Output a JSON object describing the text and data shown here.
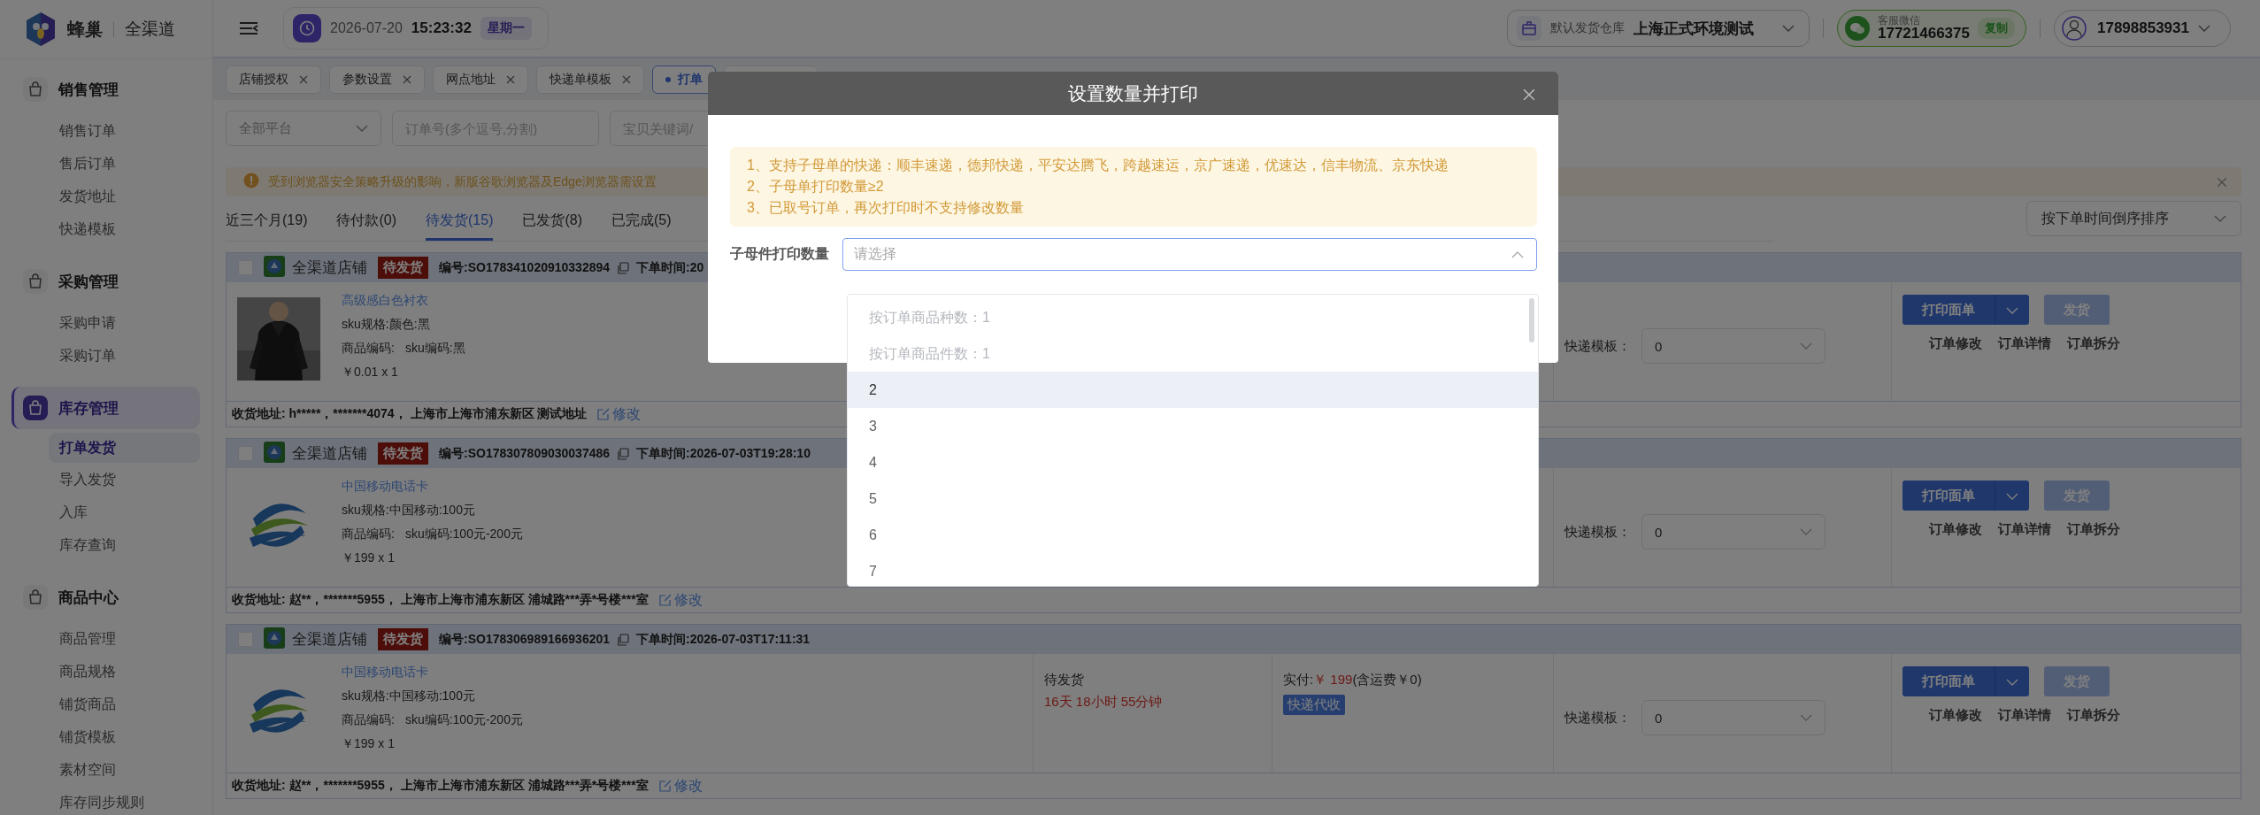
{
  "sidebar": {
    "brand": "蜂巢",
    "brand_sub": "全渠道",
    "groups": [
      {
        "title": "销售管理",
        "selected": false,
        "items": [
          {
            "label": "销售订单",
            "selected": false
          },
          {
            "label": "售后订单",
            "selected": false
          },
          {
            "label": "发货地址",
            "selected": false
          },
          {
            "label": "快递模板",
            "selected": false
          }
        ]
      },
      {
        "title": "采购管理",
        "selected": false,
        "items": [
          {
            "label": "采购申请",
            "selected": false
          },
          {
            "label": "采购订单",
            "selected": false
          }
        ]
      },
      {
        "title": "库存管理",
        "selected": true,
        "items": [
          {
            "label": "打单发货",
            "selected": true
          },
          {
            "label": "导入发货",
            "selected": false
          },
          {
            "label": "入库",
            "selected": false
          },
          {
            "label": "库存查询",
            "selected": false
          }
        ]
      },
      {
        "title": "商品中心",
        "selected": false,
        "items": [
          {
            "label": "商品管理",
            "selected": false
          },
          {
            "label": "商品规格",
            "selected": false
          },
          {
            "label": "铺货商品",
            "selected": false
          },
          {
            "label": "铺货模板",
            "selected": false
          },
          {
            "label": "素材空间",
            "selected": false
          },
          {
            "label": "库存同步规则",
            "selected": false
          }
        ]
      }
    ]
  },
  "header": {
    "date": "2026-07-20",
    "time": "15:23:32",
    "weekday": "星期一",
    "warehouse": {
      "label": "默认发货仓库",
      "value": "上海正式环境测试"
    },
    "wechat": {
      "label": "客服微信",
      "number": "17721466375",
      "copy": "复制"
    },
    "user": "17898853931"
  },
  "page_tabs": [
    {
      "kind": "text",
      "label": "店铺授权",
      "selected": false
    },
    {
      "kind": "text",
      "label": "参数设置",
      "selected": false
    },
    {
      "kind": "text",
      "label": "网点地址",
      "selected": false
    },
    {
      "kind": "text",
      "label": "快递单模板",
      "selected": false
    },
    {
      "kind": "text",
      "label": "打单",
      "selected": true
    },
    {
      "kind": "blank",
      "selected": false
    }
  ],
  "filters": {
    "platform": "全部平台",
    "order_no": {
      "placeholder": "订单号(多个逗号,分割)"
    },
    "keyword": {
      "placeholder": "宝贝关键词/"
    }
  },
  "alert": "受到浏览器安全策略升级的影响，新版谷歌浏览器及Edge浏览器需设置",
  "status_tabs": [
    {
      "label": "近三个月(19)",
      "selected": false
    },
    {
      "label": "待付款(0)",
      "selected": false
    },
    {
      "label": "待发货(15)",
      "selected": true
    },
    {
      "label": "已发货(8)",
      "selected": false
    },
    {
      "label": "已完成(5)",
      "selected": false
    }
  ],
  "sort": "按下单时间倒序排序",
  "orders": [
    {
      "checked": false,
      "store": "全渠道店铺",
      "badge": "待发货",
      "order_no": "编号:SO178341020910332894",
      "order_time": "下单时间:20",
      "product": {
        "name": "高级感白色衬衣",
        "sku": "sku规格:颜色:黑",
        "code_label": "商品编码:",
        "code": "sku编码:黑",
        "price": "￥0.01 x 1"
      },
      "address": "收货地址: h*****，*******4074， 上海市上海市浦东新区 测试地址",
      "edit": "修改",
      "template_label": "快递模板：",
      "template": "0",
      "print": "打印面单",
      "ship": "发货",
      "ship_disabled": true,
      "links": [
        "订单修改",
        "订单详情",
        "订单拆分"
      ]
    },
    {
      "checked": false,
      "store": "全渠道店铺",
      "badge": "待发货",
      "order_no": "编号:SO178307809030037486",
      "order_time": "下单时间:2026-07-03T19:28:10",
      "product": {
        "kind": "logo",
        "name": "中国移动电话卡",
        "sku": "sku规格:中国移动:100元",
        "code_label": "商品编码:",
        "code": "sku编码:100元-200元",
        "price": "￥199 x 1"
      },
      "address": "收货地址: 赵**，*******5955， 上海市上海市浦东新区 浦城路***弄*号楼***室",
      "edit": "修改",
      "template_label": "快递模板：",
      "template": "0",
      "print": "打印面单",
      "ship": "发货",
      "ship_disabled": true,
      "links": [
        "订单修改",
        "订单详情",
        "订单拆分"
      ]
    },
    {
      "checked": false,
      "store": "全渠道店铺",
      "badge": "待发货",
      "order_no": "编号:SO178306989166936201",
      "order_time": "下单时间:2026-07-03T17:11:31",
      "product": {
        "kind": "logo",
        "name": "中国移动电话卡",
        "sku": "sku规格:中国移动:100元",
        "code_label": "商品编码:",
        "code": "sku编码:100元-200元",
        "price": "￥199 x 1"
      },
      "status": "待发货",
      "countdown": "16天 18小时 55分钟",
      "paid_label": "实付:",
      "paid": "￥ 199",
      "shipping_fee": "(含运费￥0)",
      "tag": "快递代收",
      "address": "收货地址: 赵**，*******5955， 上海市上海市浦东新区 浦城路***弄*号楼***室",
      "edit": "修改",
      "template_label": "快递模板：",
      "template": "0",
      "print": "打印面单",
      "ship": "发货",
      "ship_disabled": true,
      "links": [
        "订单修改",
        "订单详情",
        "订单拆分"
      ]
    }
  ],
  "modal": {
    "title": "设置数量并打印",
    "notes": [
      "1、支持子母单的快递：顺丰速递，德邦快递，平安达腾飞，跨越速运，京广速递，优速达，信丰物流、京东快递",
      "2、子母单打印数量≥2",
      "3、已取号订单，再次打印时不支持修改数量"
    ],
    "field_label": "子母件打印数量",
    "placeholder": "请选择",
    "expanded": true,
    "options": [
      {
        "label": "按订单商品种数：1",
        "disabled": true,
        "highlighted": false
      },
      {
        "label": "按订单商品件数：1",
        "disabled": true,
        "highlighted": false
      },
      {
        "label": "2",
        "disabled": false,
        "highlighted": true
      },
      {
        "label": "3",
        "disabled": false,
        "highlighted": false
      },
      {
        "label": "4",
        "disabled": false,
        "highlighted": false
      },
      {
        "label": "5",
        "disabled": false,
        "highlighted": false
      },
      {
        "label": "6",
        "disabled": false,
        "highlighted": false
      },
      {
        "label": "7",
        "disabled": false,
        "highlighted": false
      }
    ]
  }
}
